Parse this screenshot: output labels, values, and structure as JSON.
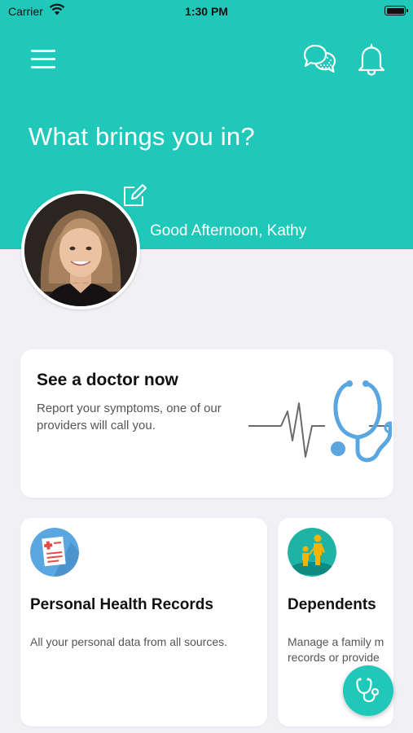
{
  "status_bar": {
    "carrier": "Carrier",
    "time": "1:30 PM"
  },
  "header": {
    "title": "What brings you in?",
    "greeting": "Good Afternoon, Kathy",
    "icons": [
      "menu-icon",
      "chat-icon",
      "bell-icon",
      "edit-icon"
    ]
  },
  "doctor_card": {
    "title": "See a doctor now",
    "description": "Report your symptoms, one of our providers will call you.",
    "icon": "stethoscope-heartbeat-icon"
  },
  "cards": [
    {
      "title": "Personal Health Records",
      "description": "All your personal data from all sources.",
      "icon": "medical-record-icon"
    },
    {
      "title": "Dependents",
      "description_line1": "Manage a family m",
      "description_line2": "records or provide",
      "icon": "family-icon"
    }
  ],
  "fab": {
    "icon": "stethoscope-icon"
  },
  "colors": {
    "brand": "#1fc8b9",
    "background": "#f1f1f5",
    "card": "#ffffff",
    "icon_blue": "#5aa6e0"
  }
}
